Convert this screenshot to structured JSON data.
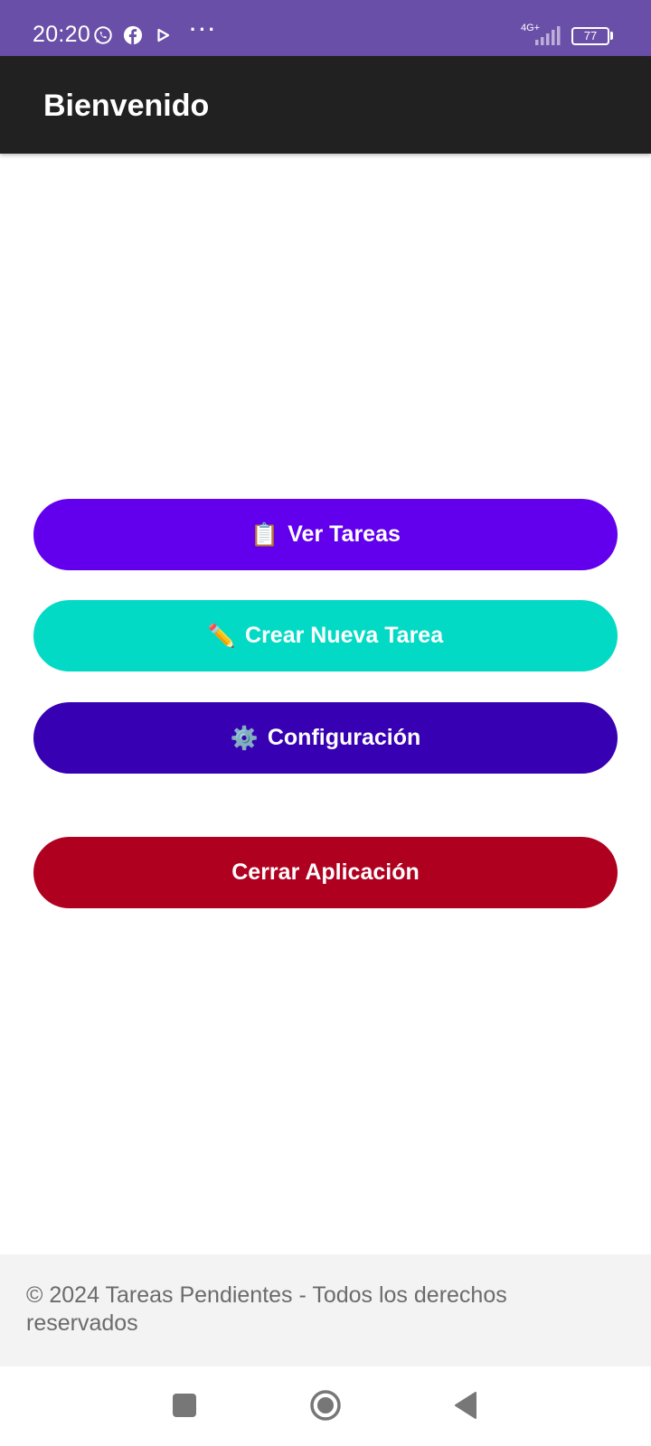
{
  "status_bar": {
    "time": "20:20",
    "dots": "···",
    "network": "4G+",
    "battery": "77",
    "icons": [
      "whatsapp-icon",
      "facebook-icon",
      "play-icon",
      "signal-icon"
    ]
  },
  "app_bar": {
    "title": "Bienvenido"
  },
  "buttons": {
    "tasks": {
      "icon": "📋",
      "label": "Ver Tareas",
      "color": "#6200ee"
    },
    "create": {
      "icon": "✏️",
      "label": "Crear Nueva Tarea",
      "color": "#03dac5"
    },
    "config": {
      "icon": "⚙️",
      "label": "Configuración",
      "color": "#3700b3"
    },
    "close": {
      "label": "Cerrar Aplicación",
      "color": "#b00020"
    }
  },
  "footer": {
    "text": "© 2024 Tareas Pendientes - Todos los derechos reservados"
  },
  "colors": {
    "status_bar": "#6a4fa8",
    "app_bar": "#212121",
    "footer_bg": "#f3f3f3"
  }
}
